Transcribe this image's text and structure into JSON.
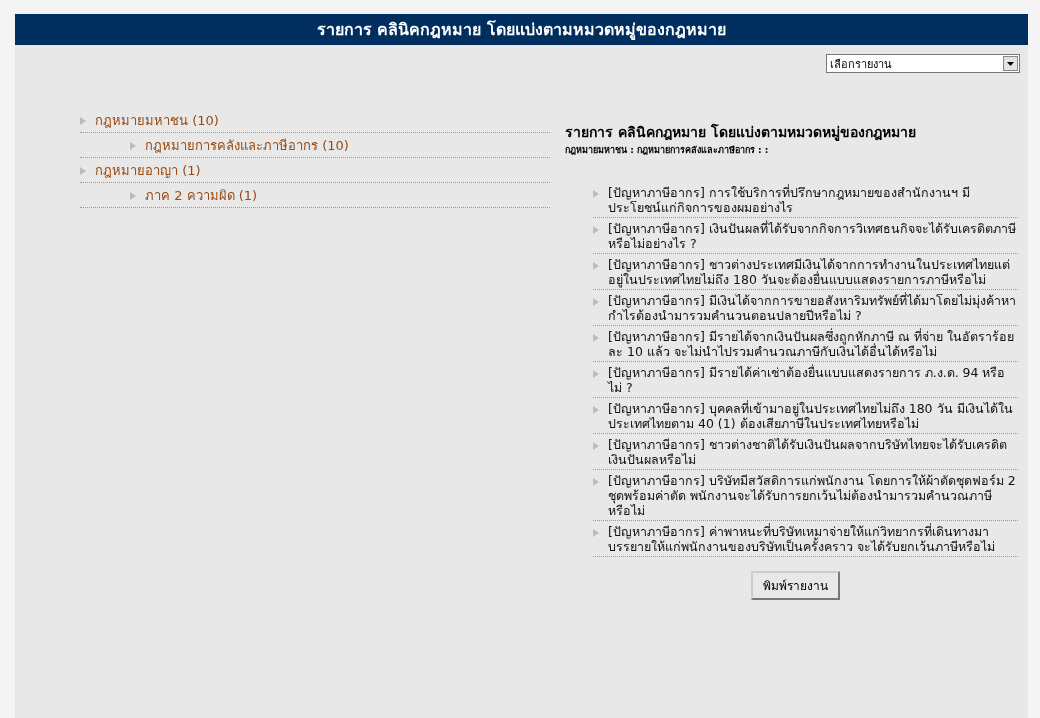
{
  "header": {
    "title": "รายการ คลินิคกฎหมาย โดยแบ่งตามหมวดหมู่ของกฎหมาย"
  },
  "report_select": {
    "value": "เลือกรายงาน"
  },
  "categories": [
    {
      "label": "กฎหมายมหาชน (10)",
      "children": [
        {
          "label": "กฎหมายการคลังและภาษีอากร (10)"
        }
      ]
    },
    {
      "label": "กฎหมายอาญา (1)",
      "children": [
        {
          "label": "ภาค 2 ความผิด (1)"
        }
      ]
    }
  ],
  "results": {
    "title": "รายการ คลินิคกฎหมาย โดยแบ่งตามหมวดหมู่ของกฎหมาย",
    "breadcrumb": "กฎหมายมหาชน : กฎหมายการคลังและภาษีอากร : :",
    "items": [
      "[ปัญหาภาษีอากร] การใช้บริการที่ปรึกษากฎหมายของสำนักงานฯ มีประโยชน์แก่กิจการของผมอย่างไร",
      "[ปัญหาภาษีอากร] เงินปันผลที่ได้รับจากกิจการวิเทศธนกิจจะได้รับเครดิตภาษีหรือไม่อย่างไร ?",
      "[ปัญหาภาษีอากร] ชาวต่างประเทศมีเงินได้จากการทำงานในประเทศไทยแต่อยู่ในประเทศไทยไม่ถึง 180 วันจะต้องยื่นแบบแสดงรายการภาษีหรือไม่",
      "[ปัญหาภาษีอากร] มีเงินได้จากการขายอสังหาริมทรัพย์ที่ได้มาโดยไม่มุ่งค้าหากำไรต้องนำมารวมคำนวนตอนปลายปีหรือไม่ ?",
      "[ปัญหาภาษีอากร] มีรายได้จากเงินปันผลซึ่งถูกหักภาษี ณ ที่จ่าย ในอัตราร้อยละ 10 แล้ว จะไม่นำไปรวมคำนวณภาษีกับเงินได้อื่นได้หรือไม่",
      "[ปัญหาภาษีอากร] มีรายได้ค่าเช่าต้องยื่นแบบแสดงรายการ ภ.ง.ด. 94 หรือไม่ ?",
      "[ปัญหาภาษีอากร] บุคคลที่เข้ามาอยู่ในประเทศไทยไม่ถึง 180 วัน มีเงินได้ในประเทศไทยตาม 40 (1) ต้องเสียภาษีในประเทศไทยหรือไม่",
      "[ปัญหาภาษีอากร] ชาวต่างชาติได้รับเงินปันผลจากบริษัทไทยจะได้รับเครดิตเงินปันผลหรือไม่",
      "[ปัญหาภาษีอากร] บริษัทมีสวัสดิการแก่พนักงาน โดยการให้ผ้าตัดชุดฟอร์ม 2 ชุดพร้อมค่าตัด พนักงานจะได้รับการยกเว้นไม่ต้องนำมารวมคำนวณภาษี หรือไม่",
      "[ปัญหาภาษีอากร] ค่าพาหนะที่บริษัทเหมาจ่ายให้แก่วิทยากรที่เดินทางมาบรรยายให้แก่พนักงานของบริษัทเป็นครั้งคราว จะได้รับยกเว้นภาษีหรือไม่"
    ]
  },
  "print_button": "พิมพ์รายงาน"
}
